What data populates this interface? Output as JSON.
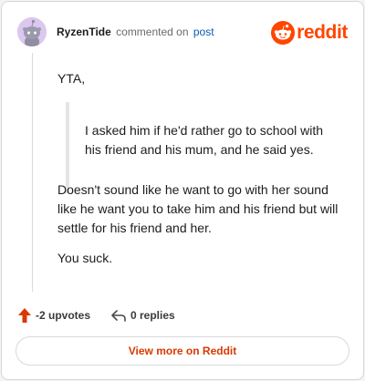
{
  "header": {
    "author": "RyzenTide",
    "verb": "commented on",
    "post_link": "post",
    "brand_name": "reddit"
  },
  "comment": {
    "opening": "YTA,",
    "quote": "I asked him if he'd rather go to school with his friend and his mum, and he said yes.",
    "paragraph_2": "Doesn't sound like he want to go with her sound like he want you to take him and his friend but will settle for his friend and her.",
    "paragraph_3": "You suck."
  },
  "footer": {
    "upvotes": "-2 upvotes",
    "replies": "0 replies"
  },
  "view_more_label": "View more on Reddit",
  "colors": {
    "brand": "#ff4500",
    "link": "#0a5bb5",
    "button_text": "#d93900"
  },
  "icons": {
    "avatar": "snoo-avatar-icon",
    "logo": "reddit-logo-icon",
    "vote": "upvote-arrow-icon",
    "reply": "reply-arrow-icon"
  }
}
